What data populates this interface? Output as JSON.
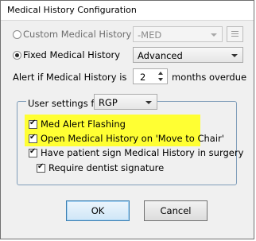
{
  "window": {
    "title": "Medical History Configuration"
  },
  "custom": {
    "label": "Custom Medical History",
    "selected": false,
    "combo_value": "-MED"
  },
  "fixed": {
    "label": "Fixed Medical History",
    "selected": true,
    "combo_value": "Advanced"
  },
  "alert": {
    "label": "Alert if Medical History is",
    "value": "2",
    "suffix": "months overdue"
  },
  "user_settings": {
    "label": "User settings for",
    "user_value": "RGP",
    "options": [
      {
        "label": "Med Alert Flashing",
        "checked": true
      },
      {
        "label": "Open Medical History on 'Move to Chair'",
        "checked": true
      },
      {
        "label": "Have patient sign Medical History in surgery",
        "checked": true
      },
      {
        "label": "Require dentist signature",
        "checked": true
      }
    ]
  },
  "buttons": {
    "ok": "OK",
    "cancel": "Cancel"
  },
  "colors": {
    "highlight": "#ffff33",
    "default_button": "#3c7fb1"
  }
}
